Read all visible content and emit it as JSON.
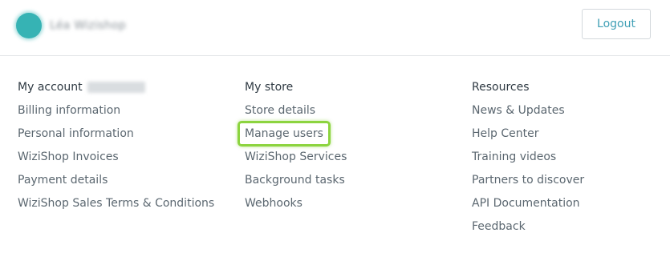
{
  "header": {
    "user_name": "Léa Wizishop",
    "logout_label": "Logout"
  },
  "columns": [
    {
      "title": "My account",
      "items": [
        "Billing information",
        "Personal information",
        "WiziShop Invoices",
        "Payment details",
        "WiziShop Sales Terms & Conditions"
      ]
    },
    {
      "title": "My store",
      "items": [
        "Store details",
        "Manage users",
        "WiziShop Services",
        "Background tasks",
        "Webhooks"
      ]
    },
    {
      "title": "Resources",
      "items": [
        "News & Updates",
        "Help Center",
        "Training videos",
        "Partners to discover",
        "API Documentation",
        "Feedback"
      ]
    }
  ],
  "colors": {
    "avatar": "#36b3b4",
    "highlight": "#8cd43f",
    "logout_text": "#3f9fb5"
  }
}
